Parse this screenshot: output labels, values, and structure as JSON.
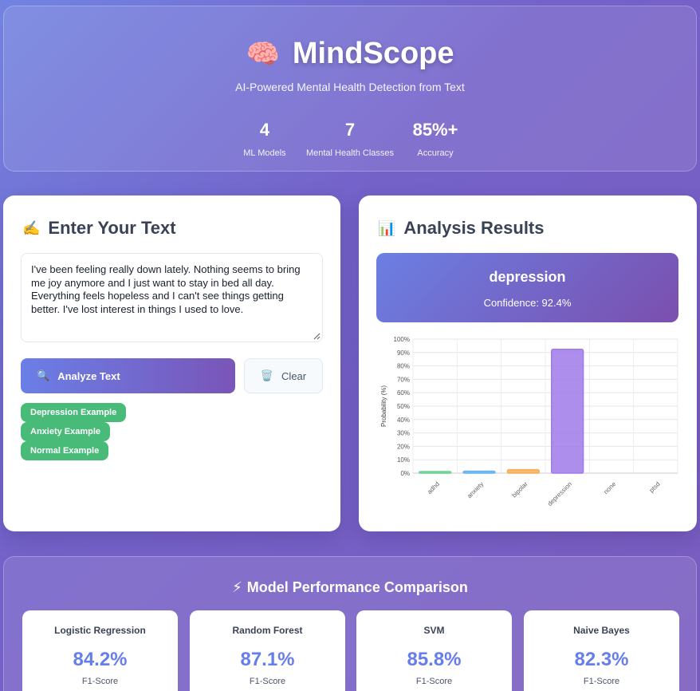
{
  "header": {
    "brain_icon": "🧠",
    "title": "MindScope",
    "subtitle": "AI-Powered Mental Health Detection from Text",
    "stats": [
      {
        "value": "4",
        "label": "ML Models"
      },
      {
        "value": "7",
        "label": "Mental Health Classes"
      },
      {
        "value": "85%+",
        "label": "Accuracy"
      }
    ]
  },
  "input_card": {
    "icon": "✍️",
    "title": "Enter Your Text",
    "text_value": "I've been feeling really down lately. Nothing seems to bring me joy anymore and I just want to stay in bed all day. Everything feels hopeless and I can't see things getting better. I've lost interest in things I used to love.",
    "analyze_icon": "🔍",
    "analyze_label": "Analyze Text",
    "clear_icon": "🗑️",
    "clear_label": "Clear",
    "examples": [
      "Depression Example",
      "Anxiety Example",
      "Normal Example"
    ]
  },
  "results_card": {
    "icon": "📊",
    "title": "Analysis Results",
    "prediction": "depression",
    "confidence_text": "Confidence: 92.4%"
  },
  "chart_data": {
    "type": "bar",
    "categories": [
      "adhd",
      "anxiety",
      "bipolar",
      "depression",
      "none",
      "ptsd"
    ],
    "values": [
      1.2,
      1.5,
      2.6,
      92.4,
      0,
      0
    ],
    "colors": [
      "#68d391",
      "#63b3ed",
      "#f6ad55",
      "#9f7aea",
      "#ed64a6",
      "#4fd1c5"
    ],
    "ylabel": "Probability (%)",
    "ylim": [
      0,
      100
    ],
    "yticks": [
      "0%",
      "10%",
      "20%",
      "30%",
      "40%",
      "50%",
      "60%",
      "70%",
      "80%",
      "90%",
      "100%"
    ],
    "grid": true
  },
  "performance": {
    "icon": "⚡",
    "title": "Model Performance Comparison",
    "models": [
      {
        "name": "Logistic Regression",
        "score": "84.2%",
        "metric": "F1-Score"
      },
      {
        "name": "Random Forest",
        "score": "87.1%",
        "metric": "F1-Score"
      },
      {
        "name": "SVM",
        "score": "85.8%",
        "metric": "F1-Score"
      },
      {
        "name": "Naive Bayes",
        "score": "82.3%",
        "metric": "F1-Score"
      }
    ]
  }
}
